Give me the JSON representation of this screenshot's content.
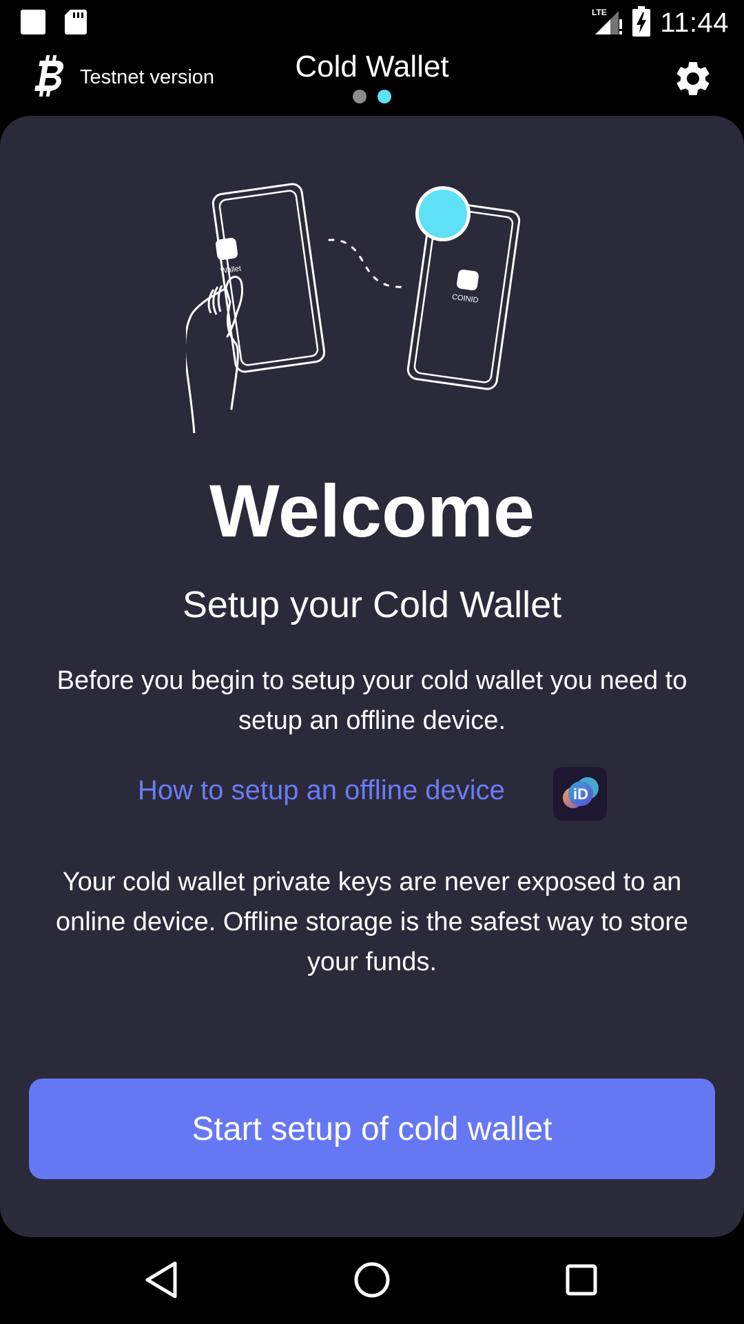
{
  "status_bar": {
    "time": "11:44",
    "network": "LTE",
    "icons": [
      "notification-square-icon",
      "sd-card-icon",
      "lte-signal-icon",
      "battery-charging-icon"
    ]
  },
  "app_bar": {
    "logo_icon": "bitcoin-logo-icon",
    "testnet_label": "Testnet version",
    "title": "Cold Wallet",
    "pager": {
      "total": 2,
      "active_index": 1
    },
    "settings_icon": "gear-icon"
  },
  "illustration": {
    "left_phone_label": "Wallet",
    "right_phone_label": "COINID"
  },
  "content": {
    "welcome": "Welcome",
    "subtitle": "Setup your Cold Wallet",
    "intro_text": "Before you begin to setup your cold wallet you need to setup an offline device.",
    "help_link": "How to setup an offline device",
    "help_badge_text": "iD",
    "safety_text": "Your cold wallet private keys are never exposed to an online device. Offline storage is the safest way to store your funds.",
    "start_button": "Start setup of cold wallet"
  },
  "nav_bar": {
    "icons": [
      "back-triangle-icon",
      "home-circle-icon",
      "recents-square-icon"
    ]
  },
  "colors": {
    "background": "#000000",
    "card": "#2a2a3b",
    "accent_button": "#6677f4",
    "link": "#6b7cf6",
    "cyan": "#5ee1f7",
    "dot_inactive": "#8c8c8c"
  }
}
